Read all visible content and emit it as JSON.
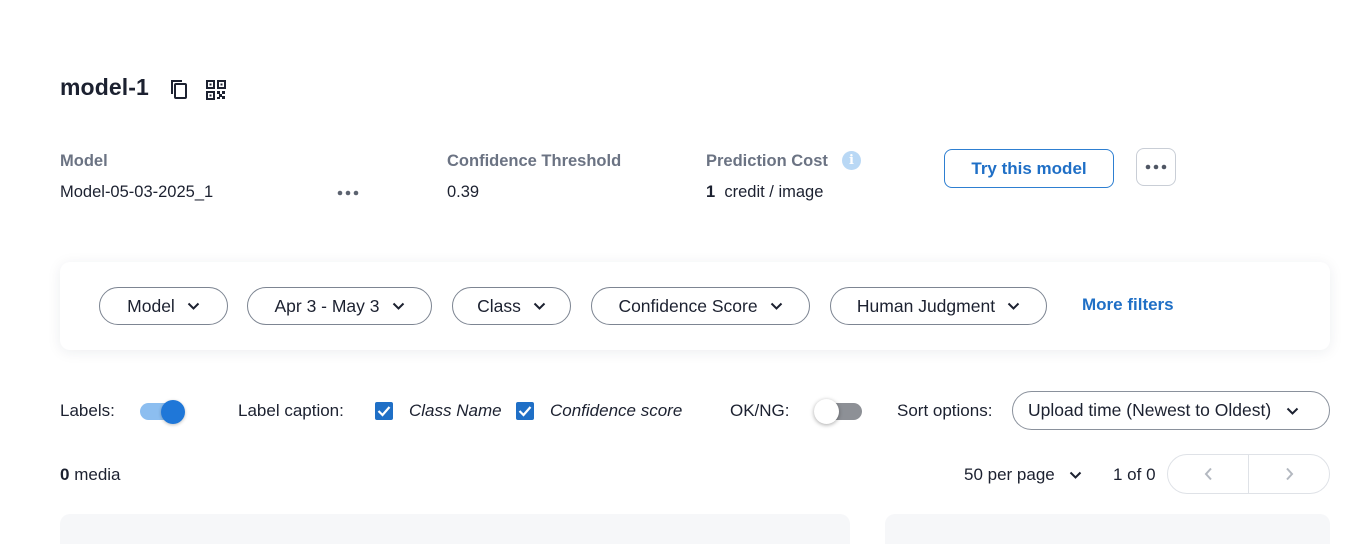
{
  "header": {
    "title": "model-1",
    "copy_icon": "copy-icon",
    "qr_icon": "qr-code-icon"
  },
  "meta": {
    "model_label": "Model",
    "model_value": "Model-05-03-2025_1",
    "threshold_label": "Confidence Threshold",
    "threshold_value": "0.39",
    "cost_label": "Prediction Cost",
    "cost_amount": "1",
    "cost_unit": "credit / image",
    "info_icon": "info-icon"
  },
  "actions": {
    "try_label": "Try this model",
    "more_icon": "more-horizontal-icon"
  },
  "filters": {
    "items": [
      {
        "label": "Model"
      },
      {
        "label": "Apr 3 - May 3"
      },
      {
        "label": "Class"
      },
      {
        "label": "Confidence Score"
      },
      {
        "label": "Human Judgment"
      }
    ],
    "more_label": "More filters"
  },
  "display": {
    "labels_label": "Labels:",
    "labels_on": true,
    "caption_label": "Label caption:",
    "class_name_label": "Class Name",
    "class_name_checked": true,
    "confidence_label": "Confidence score",
    "confidence_checked": true,
    "okng_label": "OK/NG:",
    "okng_on": false,
    "sort_label": "Sort options:",
    "sort_value": "Upload time (Newest to Oldest)"
  },
  "results": {
    "count": "0",
    "count_suffix": "media",
    "per_page": "50 per page",
    "page_info": "1 of 0"
  },
  "colors": {
    "accent": "#1f6fc6",
    "toggle_on_track": "#8cbef0",
    "toggle_on_knob": "#1f77d8",
    "toggle_off_track": "#8d9096"
  }
}
